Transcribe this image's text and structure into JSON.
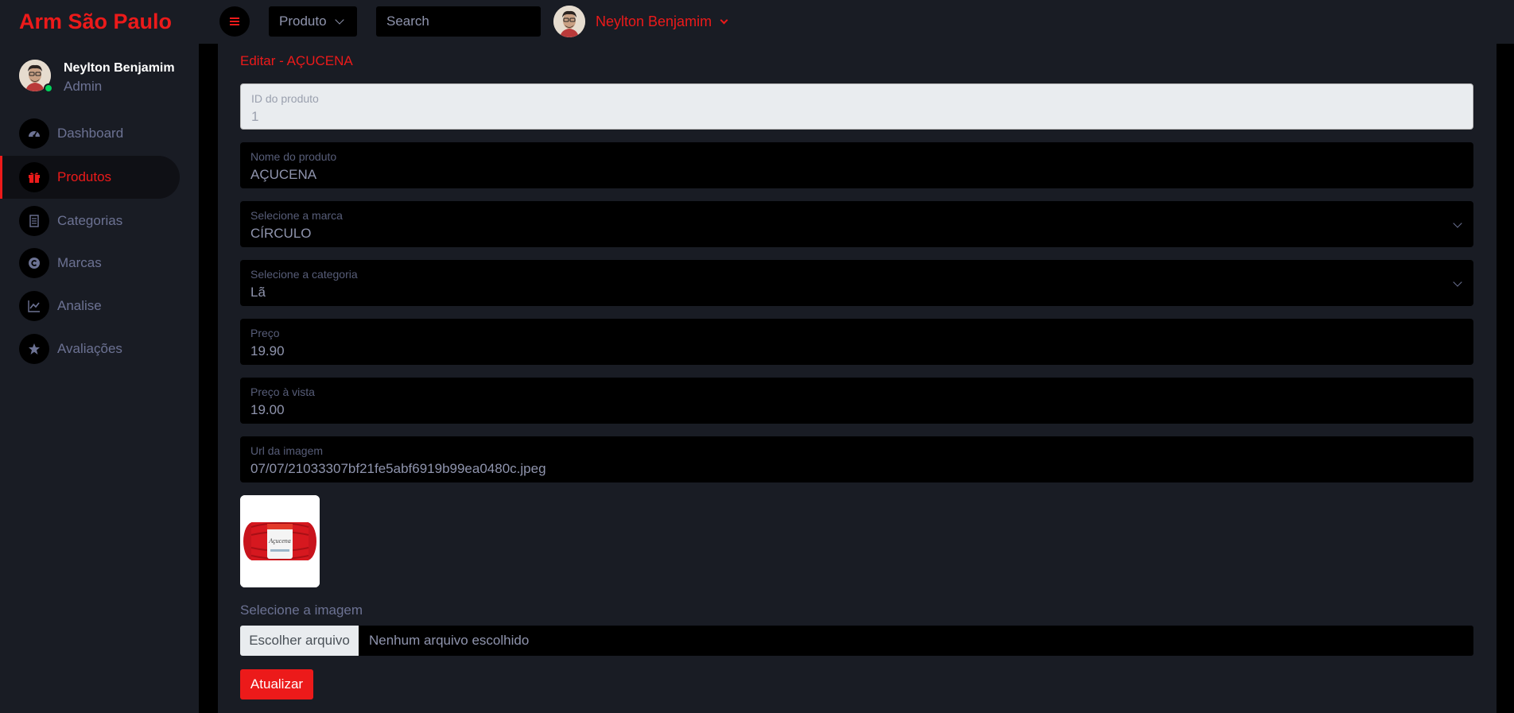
{
  "brand": "Arm São Paulo",
  "topbar": {
    "dropdown_label": "Produto",
    "search_placeholder": "Search",
    "profile_name": "Neylton Benjamim"
  },
  "sidebar": {
    "profile": {
      "name": "Neylton Benjamim",
      "role": "Admin"
    },
    "items": [
      {
        "label": "Dashboard",
        "icon": "speedometer-icon",
        "active": false
      },
      {
        "label": "Produtos",
        "icon": "gift-box-icon",
        "active": true
      },
      {
        "label": "Categorias",
        "icon": "list-icon",
        "active": false
      },
      {
        "label": "Marcas",
        "icon": "copyright-icon",
        "active": false
      },
      {
        "label": "Analise",
        "icon": "chart-line-icon",
        "active": false
      },
      {
        "label": "Avaliações",
        "icon": "star-icon",
        "active": false
      }
    ]
  },
  "form": {
    "title": "Editar - AÇUCENA",
    "fields": [
      {
        "label": "ID do produto",
        "value": "1"
      },
      {
        "label": "Nome do produto",
        "value": "AÇUCENA"
      },
      {
        "label": "Selecione a marca",
        "value": "CÍRCULO"
      },
      {
        "label": "Selecione a categoria",
        "value": "Lã"
      },
      {
        "label": "Preço",
        "value": "19.90"
      },
      {
        "label": "Preço à vista",
        "value": "19.00"
      },
      {
        "label": "Url da imagem",
        "value": "07/07/21033307bf21fe5abf6919b99ea0480c.jpeg"
      }
    ],
    "image_select_label": "Selecione a imagem",
    "file_button": "Escolher arquivo",
    "file_status": "Nenhum arquivo escolhido",
    "submit_label": "Atualizar"
  },
  "colors": {
    "accent": "#ec1a1a",
    "background": "#191c24",
    "field_bg": "#000000",
    "online": "#00d25b"
  }
}
